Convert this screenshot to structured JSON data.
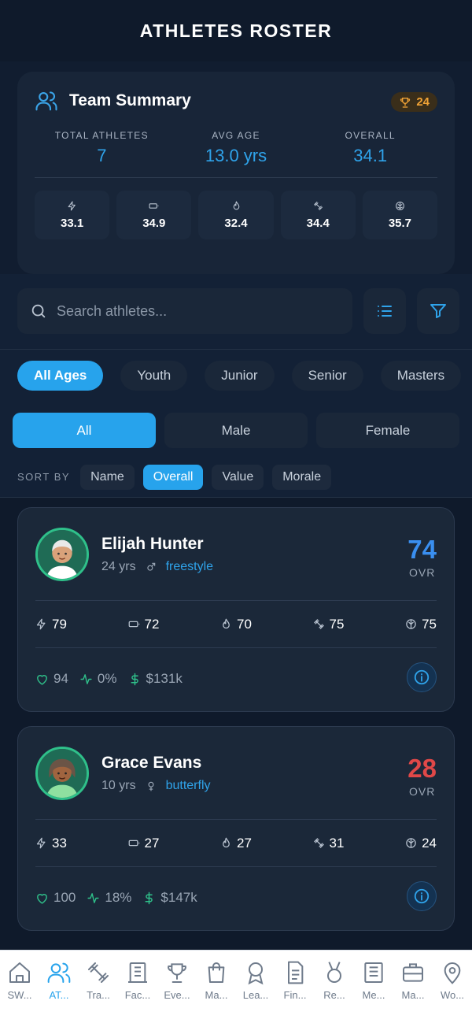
{
  "page_title": "ATHLETES ROSTER",
  "summary": {
    "title": "Team Summary",
    "trophy_count": "24",
    "stats": [
      {
        "label": "TOTAL ATHLETES",
        "value": "7"
      },
      {
        "label": "AVG AGE",
        "value": "13.0 yrs"
      },
      {
        "label": "OVERALL",
        "value": "34.1"
      }
    ],
    "attributes": [
      {
        "icon": "lightning-icon",
        "value": "33.1"
      },
      {
        "icon": "battery-icon",
        "value": "34.9"
      },
      {
        "icon": "flame-icon",
        "value": "32.4"
      },
      {
        "icon": "dumbbell-icon",
        "value": "34.4"
      },
      {
        "icon": "brain-icon",
        "value": "35.7"
      }
    ]
  },
  "search": {
    "placeholder": "Search athletes..."
  },
  "age_filters": [
    "All Ages",
    "Youth",
    "Junior",
    "Senior",
    "Masters"
  ],
  "gender_filters": [
    "All",
    "Male",
    "Female"
  ],
  "sort": {
    "label": "SORT BY",
    "options": [
      "Name",
      "Overall",
      "Value",
      "Morale"
    ]
  },
  "athletes": [
    {
      "name": "Elijah Hunter",
      "age": "24 yrs",
      "gender_icon": "male-icon",
      "stroke": "freestyle",
      "ovr": "74",
      "ovr_label": "OVR",
      "ovr_color": "#3a8ff0",
      "attrs": [
        "79",
        "72",
        "70",
        "75",
        "75"
      ],
      "morale": "94",
      "trend": "0%",
      "value": "$131k"
    },
    {
      "name": "Grace Evans",
      "age": "10 yrs",
      "gender_icon": "female-icon",
      "stroke": "butterfly",
      "ovr": "28",
      "ovr_label": "OVR",
      "ovr_color": "#e04848",
      "attrs": [
        "33",
        "27",
        "27",
        "31",
        "24"
      ],
      "morale": "100",
      "trend": "18%",
      "value": "$147k"
    }
  ],
  "tabs": [
    {
      "label": "SW...",
      "icon": "home-icon"
    },
    {
      "label": "AT...",
      "icon": "users-icon"
    },
    {
      "label": "Tra...",
      "icon": "dumbbell-icon"
    },
    {
      "label": "Fac...",
      "icon": "building-icon"
    },
    {
      "label": "Eve...",
      "icon": "trophy-icon"
    },
    {
      "label": "Ma...",
      "icon": "shopping-bag-icon"
    },
    {
      "label": "Lea...",
      "icon": "award-icon"
    },
    {
      "label": "Fin...",
      "icon": "document-icon"
    },
    {
      "label": "Re...",
      "icon": "medal-icon"
    },
    {
      "label": "Me...",
      "icon": "newspaper-icon"
    },
    {
      "label": "Ma...",
      "icon": "briefcase-icon"
    },
    {
      "label": "Wo...",
      "icon": "map-pin-icon"
    }
  ],
  "colors": {
    "accent": "#27a3ec",
    "positive": "#2fc08a",
    "gold": "#f1a336"
  }
}
